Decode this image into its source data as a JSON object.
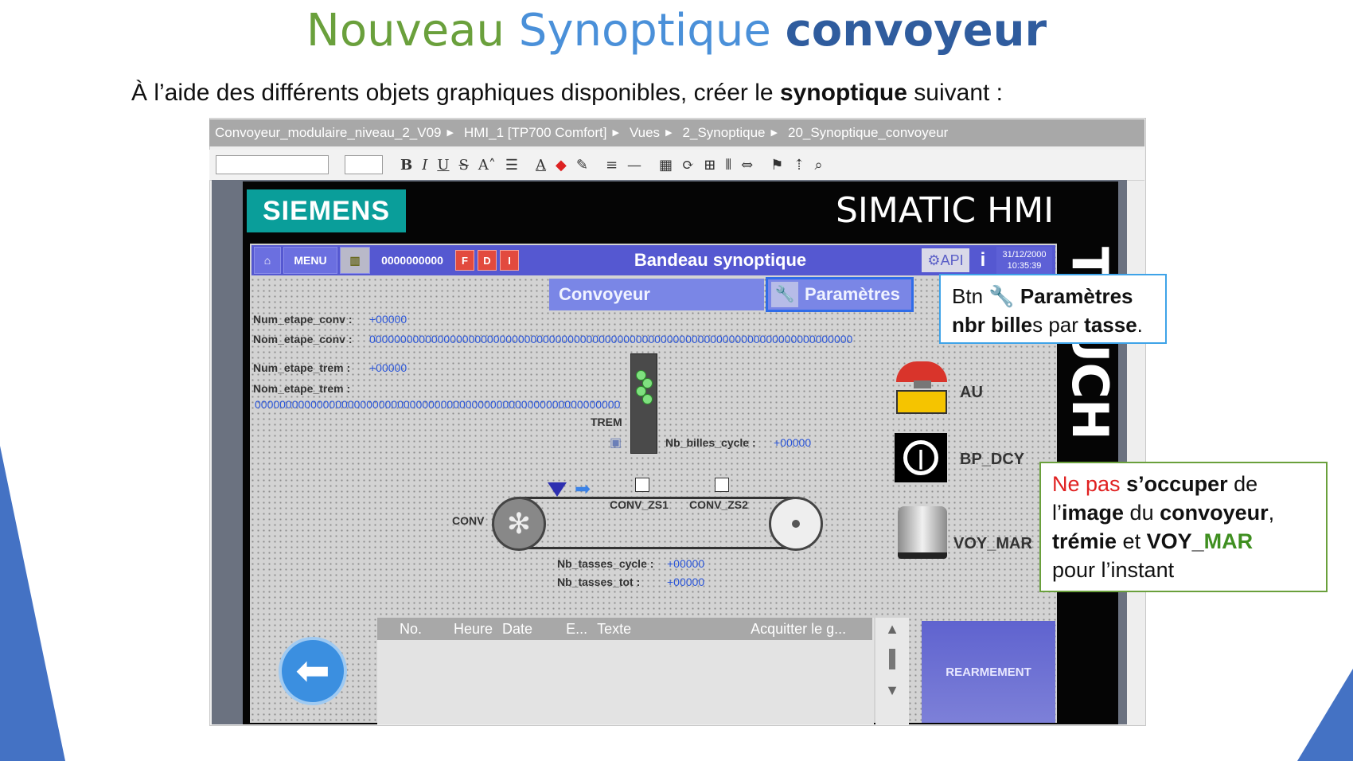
{
  "slide": {
    "title_part1": "Nouveau",
    "title_part2": "Synoptique",
    "title_part3": "convoyeur",
    "subtitle_pre": "À l’aide des différents objets graphiques disponibles, créer le ",
    "subtitle_bold": "synoptique",
    "subtitle_post": " suivant :"
  },
  "breadcrumb": [
    "Convoyeur_modulaire_niveau_2_V09",
    "HMI_1 [TP700 Comfort]",
    "Vues",
    "2_Synoptique",
    "20_Synoptique_convoyeur"
  ],
  "toolbar": {
    "bold": "B",
    "italic": "I",
    "underline": "U",
    "strike": "S",
    "fontsize": "A˄",
    "text_color": "A"
  },
  "hmi": {
    "brand": "SIEMENS",
    "product": "SIMATIC HMI",
    "side_text": "TOUCH",
    "band": {
      "menu": "MENU",
      "counter": "0000000000",
      "btn_f": "F",
      "btn_d": "D",
      "btn_i": "I",
      "title": "Bandeau synoptique",
      "api": "API",
      "info": "i",
      "date": "31/12/2000",
      "time": "10:35:39"
    },
    "tabs": {
      "convoyeur": "Convoyeur",
      "parametres": "Paramètres"
    },
    "fields": {
      "num_etape_conv_label": "Num_etape_conv :",
      "num_etape_conv_value": "+00000",
      "nom_etape_conv_label": "Nom_etape_conv :",
      "nom_etape_conv_value": "000000000000000000000000000000000000000000000000000000000000000000000000000000",
      "num_etape_trem_label": "Num_etape_trem :",
      "num_etape_trem_value": "+00000",
      "nom_etape_trem_label": "Nom_etape_trem :",
      "nom_etape_trem_value": "00000000000000000000000000000000000000000000000000000000000",
      "trem_label": "TREM",
      "nb_billes_label": "Nb_billes_cycle :",
      "nb_billes_value": "+00000",
      "conv_zs1": "CONV_ZS1",
      "conv_zs2": "CONV_ZS2",
      "conv_label": "CONV",
      "nb_tasses_cycle_label": "Nb_tasses_cycle :",
      "nb_tasses_cycle_value": "+00000",
      "nb_tasses_tot_label": "Nb_tasses_tot :",
      "nb_tasses_tot_value": "+00000"
    },
    "buttons": {
      "au": "AU",
      "bp_dcy": "BP_DCY",
      "voy_mar": "VOY_MAR",
      "rearmement": "REARMEMENT"
    },
    "alarm_columns": [
      "No.",
      "Heure",
      "Date",
      "E...",
      "Texte",
      "Acquitter le g..."
    ]
  },
  "callout1": {
    "line1_pre": "Btn ",
    "line1_bold": "Paramètres",
    "line2_bold1": "nbr bille",
    "line2_mid": "s par ",
    "line2_bold2": "tasse",
    "line2_end": "."
  },
  "callout2": {
    "red": "Ne pas",
    "bold1": "s’occuper",
    "t1": " de",
    "t2": "l’",
    "bold2": "image",
    "t3": " du ",
    "bold3": "convoyeur",
    "t4": ",",
    "bold4": "trémie",
    "t5": " et ",
    "bold5": "VOY_",
    "green": "MAR",
    "t6": "pour l’instant"
  },
  "colors": {
    "accent_blue": "#4a90d9",
    "title_green": "#6aa03c",
    "hmi_band": "#5558d1",
    "siemens_teal": "#0a9e9a"
  }
}
